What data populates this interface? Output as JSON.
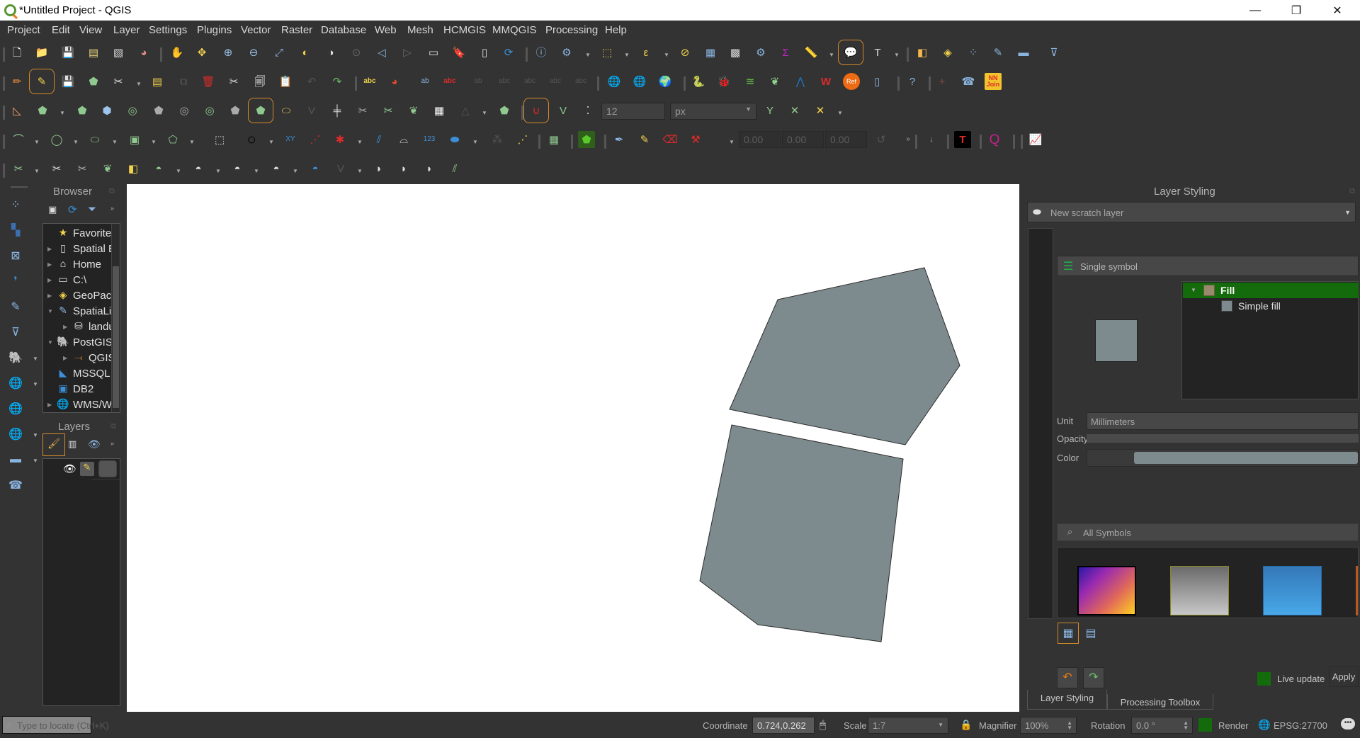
{
  "window": {
    "title": "*Untitled Project - QGIS",
    "controls": {
      "minimize": "—",
      "restore": "❐",
      "close": "✕"
    }
  },
  "menu": [
    "Project",
    "Edit",
    "View",
    "Layer",
    "Settings",
    "Plugins",
    "Vector",
    "Raster",
    "Database",
    "Web",
    "Mesh",
    "HCMGIS",
    "MMQGIS",
    "Processing",
    "Help"
  ],
  "toolbars": {
    "row1": [
      "new-project",
      "open-project",
      "save-project",
      "new-print-layout",
      "layout-manager",
      "style-manager",
      "pan",
      "pan-to-selection",
      "zoom-in",
      "zoom-out",
      "zoom-full",
      "zoom-to-selection",
      "zoom-to-layer",
      "zoom-native",
      "zoom-last",
      "zoom-next",
      "new-map-view",
      "new-bookmark",
      "show-bookmarks",
      "refresh",
      "identify",
      "run-action",
      "select-features",
      "select-by-expression",
      "deselect-all",
      "open-attribute-table",
      "open-field-calculator",
      "processing-toolbox",
      "statistical-summary",
      "measure-line",
      "map-tips",
      "text-annotation",
      "data-source-manager",
      "new-geopackage-layer",
      "new-shapefile-layer",
      "new-spatialite-layer",
      "new-virtual-layer",
      "new-temporary-layer"
    ],
    "row2": [
      "current-edits",
      "toggle-editing",
      "save-edits",
      "add-polygon",
      "vertex-tool",
      "modify-attributes",
      "copy-features",
      "delete-selected",
      "cut-features",
      "copy",
      "paste",
      "undo",
      "redo",
      "label-toolbar",
      "diagram",
      "pin-labels",
      "show-hide-labels",
      "move-label",
      "rotate-label",
      "change-label",
      "add-wms",
      "add-wcs",
      "add-wfs",
      "python-console",
      "bug",
      "plugin-a",
      "plugin-b",
      "plugin-c",
      "wkt",
      "ref",
      "plugin-d",
      "help",
      "crosshair",
      "plugin-e",
      "nn-join"
    ],
    "row3_snapping": {
      "tolerance": "12",
      "unit": "px"
    },
    "row4_fields": [
      "0.00",
      "0.00",
      "0.00"
    ]
  },
  "browser": {
    "title": "Browser",
    "items": [
      {
        "label": "Favorites",
        "icon": "star-icon",
        "expand": "none",
        "indent": 0
      },
      {
        "label": "Spatial Bookmarks",
        "icon": "bookmark-icon",
        "expand": "collapsed",
        "indent": 0
      },
      {
        "label": "Home",
        "icon": "home-icon",
        "expand": "collapsed",
        "indent": 0
      },
      {
        "label": "C:\\",
        "icon": "folder-icon",
        "expand": "collapsed",
        "indent": 0
      },
      {
        "label": "GeoPackage",
        "icon": "geopackage-icon",
        "expand": "collapsed",
        "indent": 0
      },
      {
        "label": "SpatiaLite",
        "icon": "feather-icon",
        "expand": "expanded",
        "indent": 0
      },
      {
        "label": "landuse",
        "icon": "database-icon",
        "expand": "collapsed",
        "indent": 1
      },
      {
        "label": "PostGIS",
        "icon": "elephant-icon",
        "expand": "expanded",
        "indent": 0
      },
      {
        "label": "QGIS",
        "icon": "connection-icon",
        "expand": "collapsed",
        "indent": 1
      },
      {
        "label": "MSSQL",
        "icon": "mssql-icon",
        "expand": "none",
        "indent": 0
      },
      {
        "label": "DB2",
        "icon": "db2-icon",
        "expand": "none",
        "indent": 0
      },
      {
        "label": "WMS/WMTS",
        "icon": "globe-icon",
        "expand": "collapsed",
        "indent": 0
      }
    ]
  },
  "layers": {
    "title": "Layers",
    "items": [
      {
        "label": "New scratch layer",
        "visible": true,
        "editing": true
      }
    ]
  },
  "map": {
    "fill_color": "#7e8b8e",
    "stroke_color": "#2b2b2b",
    "features": 2
  },
  "layer_styling": {
    "title": "Layer Styling",
    "layer_select": "New scratch layer",
    "renderer": "Single symbol",
    "symbol_tree": [
      {
        "label": "Fill",
        "selected": true
      },
      {
        "label": "Simple fill",
        "selected": false
      }
    ],
    "unit_label": "Unit",
    "unit_value": "Millimeters",
    "opacity_label": "Opacity",
    "color_label": "Color",
    "color_value": "#7e8b8e",
    "search_placeholder": "All Symbols",
    "live_update_label": "Live update",
    "live_update": true,
    "apply_label": "Apply",
    "tabs": [
      "Layer Styling",
      "Processing Toolbox"
    ]
  },
  "status": {
    "locator_placeholder": "Type to locate (Ctrl+K)",
    "coordinate_label": "Coordinate",
    "coordinate_value": "0.724,0.262",
    "scale_label": "Scale",
    "scale_value": "1:7",
    "magnifier_label": "Magnifier",
    "magnifier_value": "100%",
    "rotation_label": "Rotation",
    "rotation_value": "0.0 °",
    "render_label": "Render",
    "render_enabled": true,
    "crs": "EPSG:27700"
  }
}
